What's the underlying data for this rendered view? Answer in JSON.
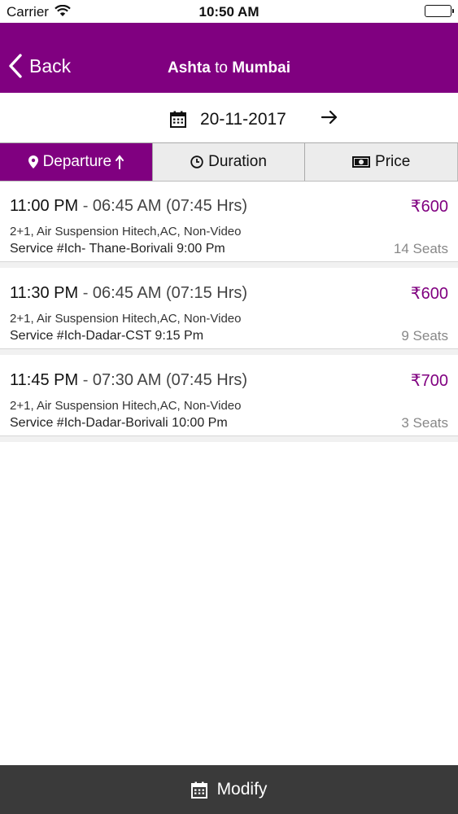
{
  "status_bar": {
    "carrier": "Carrier",
    "time": "10:50 AM"
  },
  "nav": {
    "back_label": "Back",
    "origin": "Ashta",
    "connector": "to",
    "destination": "Mumbai"
  },
  "date_row": {
    "date": "20-11-2017"
  },
  "sort_tabs": [
    {
      "label": "Departure",
      "icon": "location-pin-icon",
      "active": true
    },
    {
      "label": "Duration",
      "icon": "clock-icon",
      "active": false
    },
    {
      "label": "Price",
      "icon": "money-icon",
      "active": false
    }
  ],
  "results": [
    {
      "departure": "11:00 PM",
      "arrival": "06:45 AM",
      "duration": "(07:45 Hrs)",
      "price": "₹600",
      "bus_type": "2+1, Air Suspension Hitech,AC, Non-Video",
      "service": "Service #Ich- Thane-Borivali 9:00 Pm",
      "seats": "14 Seats"
    },
    {
      "departure": "11:30 PM",
      "arrival": "06:45 AM",
      "duration": "(07:15 Hrs)",
      "price": "₹600",
      "bus_type": "2+1, Air Suspension Hitech,AC, Non-Video",
      "service": "Service #Ich-Dadar-CST 9:15 Pm",
      "seats": "9 Seats"
    },
    {
      "departure": "11:45 PM",
      "arrival": "07:30 AM",
      "duration": "(07:45 Hrs)",
      "price": "₹700",
      "bus_type": "2+1, Air Suspension Hitech,AC, Non-Video",
      "service": "Service #Ich-Dadar-Borivali 10:00 Pm",
      "seats": "3 Seats"
    }
  ],
  "bottom_bar": {
    "modify_label": "Modify"
  },
  "colors": {
    "brand": "#800080",
    "bottom_bar": "#3a3a3a",
    "tab_inactive": "#ececec"
  }
}
